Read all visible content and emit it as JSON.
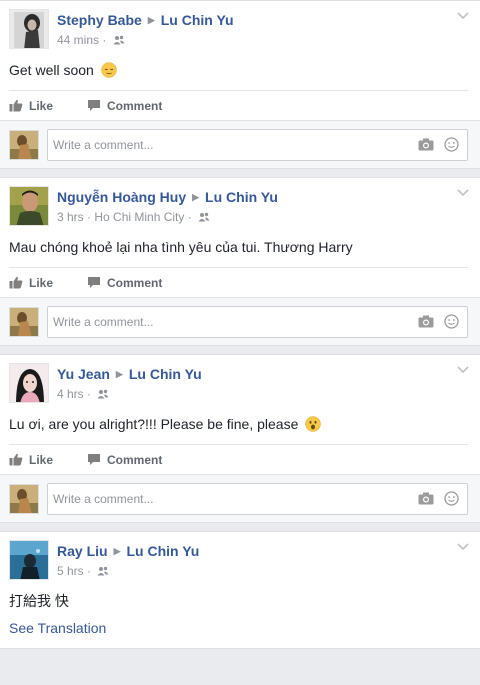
{
  "posts": [
    {
      "author": "Stephy Babe",
      "target": "Lu Chin Yu",
      "time": "44 mins",
      "location": "",
      "text": "Get well soon",
      "emoji": "relieved",
      "actions": {
        "like": "Like",
        "comment": "Comment"
      },
      "comment_placeholder": "Write a comment..."
    },
    {
      "author": "Nguyễn Hoàng Huy",
      "target": "Lu Chin Yu",
      "time": "3 hrs",
      "location": "Ho Chi Minh City",
      "text": "Mau chóng khoẻ lại nha tình yêu của tui. Thương Harry",
      "actions": {
        "like": "Like",
        "comment": "Comment"
      },
      "comment_placeholder": "Write a comment..."
    },
    {
      "author": "Yu Jean",
      "target": "Lu Chin Yu",
      "time": "4 hrs",
      "location": "",
      "text": "Lu ơi, are you alright?!!! Please be fine, please",
      "emoji": "surprised",
      "actions": {
        "like": "Like",
        "comment": "Comment"
      },
      "comment_placeholder": "Write a comment..."
    },
    {
      "author": "Ray Liu",
      "target": "Lu Chin Yu",
      "time": "5 hrs",
      "location": "",
      "text": "打給我 快",
      "see_translation": "See Translation"
    }
  ],
  "icons": {
    "privacy": "friends-icon",
    "options": "chevron-down-icon",
    "like": "thumbs-up-icon",
    "comment": "speech-bubble-icon",
    "camera": "camera-icon",
    "sticker": "smiley-icon"
  },
  "colors": {
    "link": "#365899",
    "meta": "#90949c",
    "background": "#e9ebee"
  }
}
